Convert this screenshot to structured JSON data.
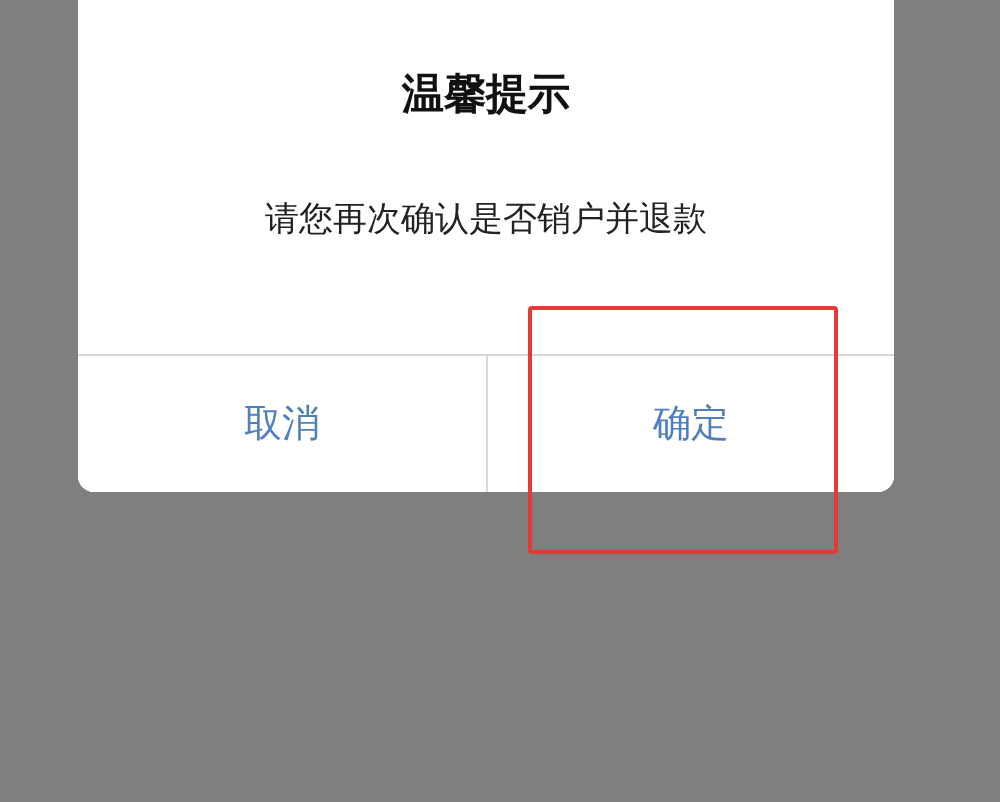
{
  "dialog": {
    "title": "温馨提示",
    "message": "请您再次确认是否销户并退款",
    "buttons": [
      {
        "label": "取消",
        "highlighted": false
      },
      {
        "label": "确定",
        "highlighted": true
      }
    ]
  }
}
